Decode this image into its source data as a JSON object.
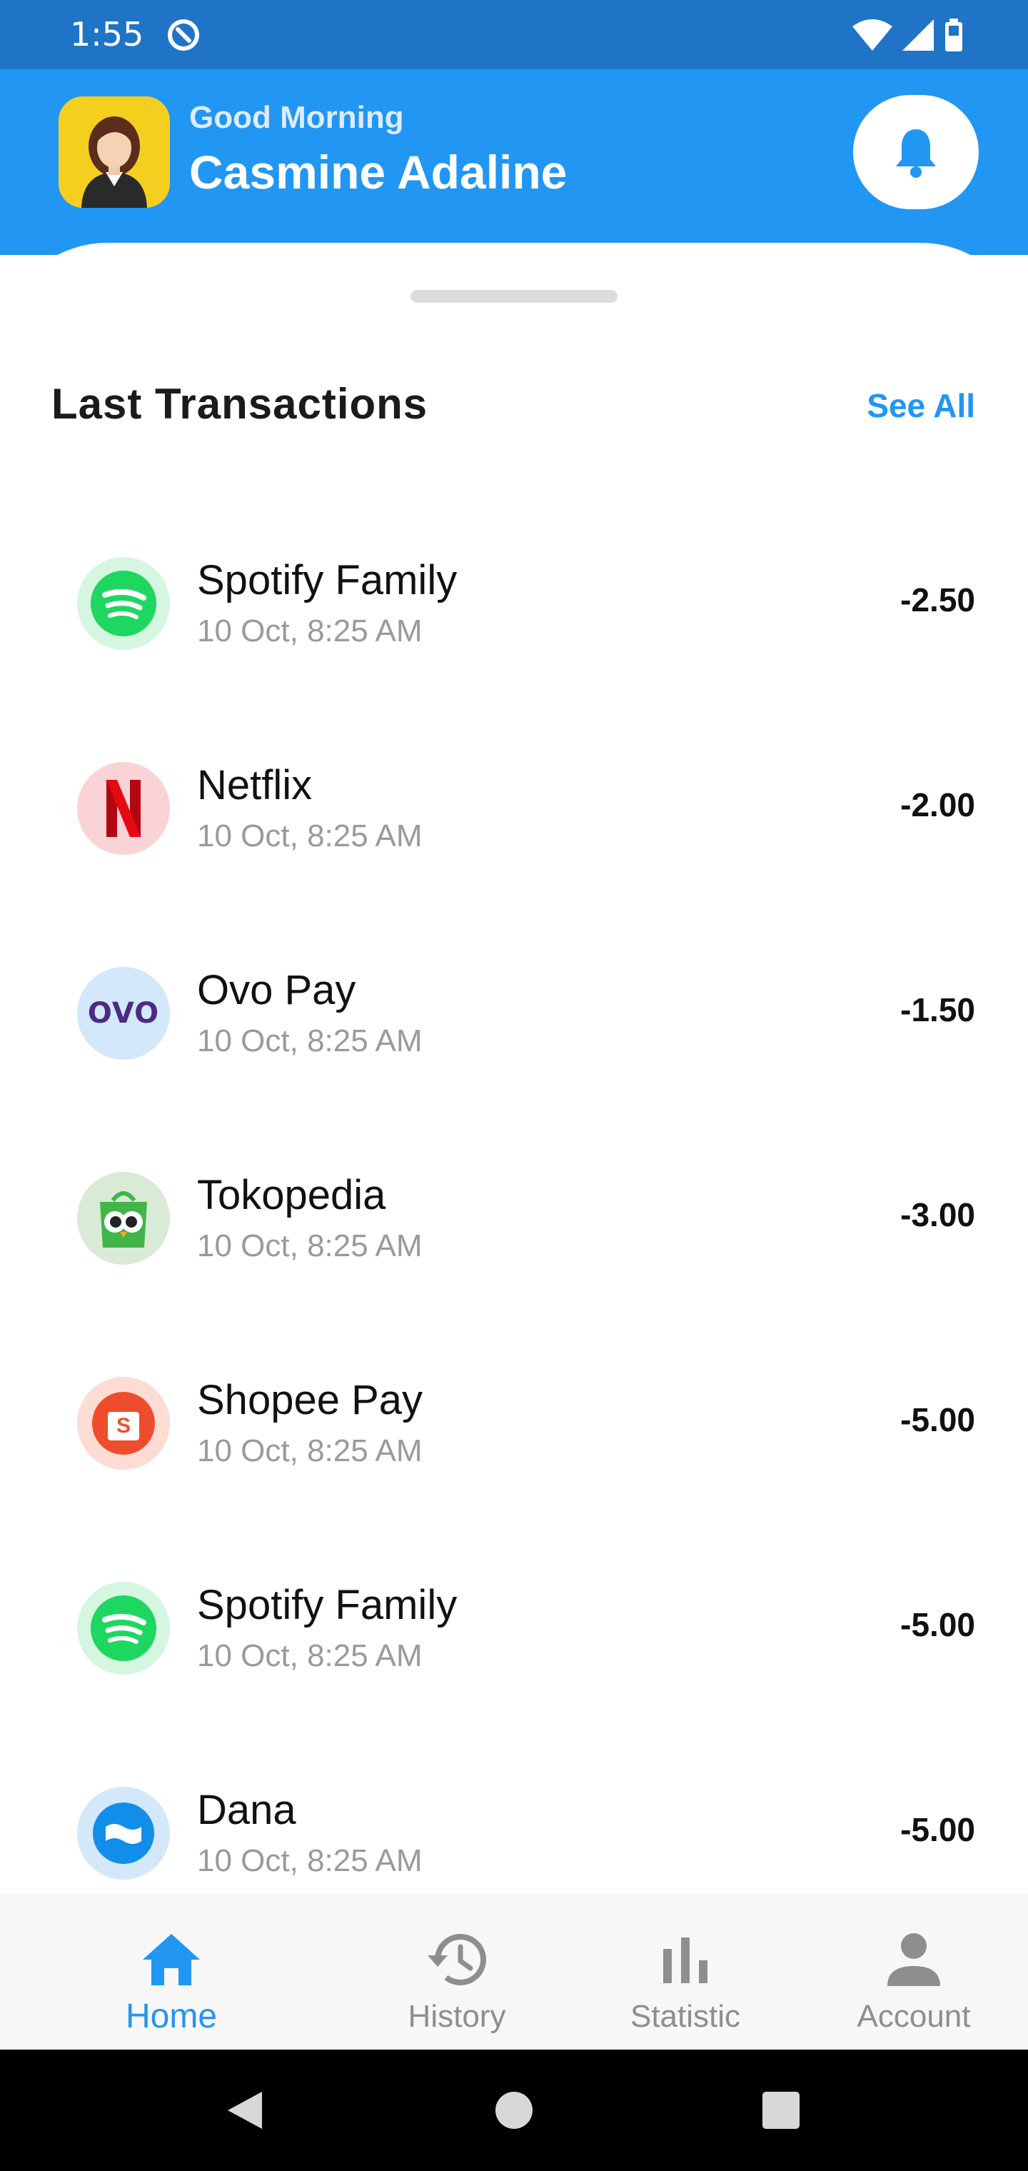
{
  "status_bar": {
    "time": "1:55",
    "icons": [
      "app-indicator-icon",
      "wifi-icon",
      "cell-signal-icon",
      "battery-icon"
    ]
  },
  "header": {
    "greeting": "Good Morning",
    "user_name": "Casmine Adaline",
    "notification_icon": "bell-icon",
    "colors": {
      "background": "#2196f3",
      "status_bar": "#1f74c8",
      "avatar_bg": "#f5cf1f"
    }
  },
  "transactions": {
    "title": "Last Transactions",
    "see_all": "See All",
    "items": [
      {
        "name": "Spotify Family",
        "date": "10 Oct, 8:25 AM",
        "amount": "-2.50",
        "icon": "spotify-icon"
      },
      {
        "name": "Netflix",
        "date": "10 Oct, 8:25 AM",
        "amount": "-2.00",
        "icon": "netflix-icon"
      },
      {
        "name": "Ovo Pay",
        "date": "10 Oct, 8:25 AM",
        "amount": "-1.50",
        "icon": "ovo-icon",
        "logo_text": "OVO"
      },
      {
        "name": "Tokopedia",
        "date": "10 Oct, 8:25 AM",
        "amount": "-3.00",
        "icon": "tokopedia-icon"
      },
      {
        "name": "Shopee Pay",
        "date": "10 Oct, 8:25 AM",
        "amount": "-5.00",
        "icon": "shopee-icon",
        "logo_text": "S"
      },
      {
        "name": "Spotify Family",
        "date": "10 Oct, 8:25 AM",
        "amount": "-5.00",
        "icon": "spotify-icon"
      },
      {
        "name": "Dana",
        "date": "10 Oct, 8:25 AM",
        "amount": "-5.00",
        "icon": "dana-icon"
      }
    ]
  },
  "bottom_nav": {
    "items": [
      {
        "label": "Home",
        "icon": "home-icon",
        "active": true
      },
      {
        "label": "History",
        "icon": "history-icon",
        "active": false
      },
      {
        "label": "Statistic",
        "icon": "bar-chart-icon",
        "active": false
      },
      {
        "label": "Account",
        "icon": "person-icon",
        "active": false
      }
    ],
    "active_color": "#2196f3",
    "inactive_color": "#8e8e8e"
  },
  "system_nav": {
    "icons": [
      "back-icon",
      "home-circle-icon",
      "recents-icon"
    ]
  }
}
